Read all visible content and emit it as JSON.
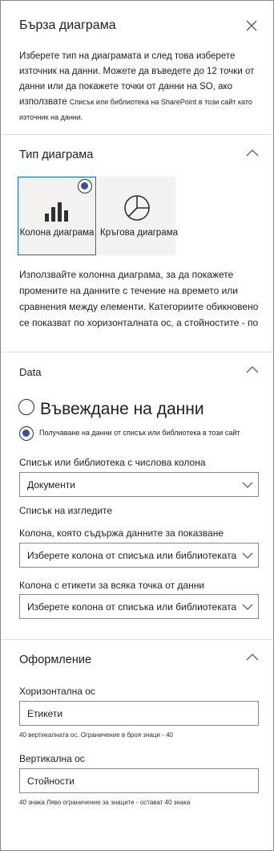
{
  "panel": {
    "title": "Бърза диаграма",
    "intro_main": "Изберете тип на диаграмата и след това изберете източник на данни. Можете да въведете до 12 точки от данни или да покажете точки от данни на SO, ако използвате ",
    "intro_small": "Списък или библиотека на SharePoint в този сайт като източник на данни."
  },
  "chart_type": {
    "section_title": "Тип диаграма",
    "options": [
      {
        "label": "Колона диаграма",
        "icon": "bar-chart-icon",
        "selected": true
      },
      {
        "label": "Кръгова диаграма",
        "icon": "pie-chart-icon",
        "selected": false
      }
    ],
    "description": "Използвайте колонна диаграма, за да покажете промените на данните с течение на времето или сравнения между елементи. Категориите обикновено се показват по хоризонталната ос, а стойностите - по"
  },
  "data": {
    "section_title": "Data",
    "radio_enter": "Въвеждане на данни",
    "radio_list": "Получаване на данни от списък или библиотека в този сайт",
    "list_label": "Списък или библиотека с числова колона",
    "list_value": "Документи",
    "views_label": "Списък на изгледите",
    "column_label": "Колона, която съдържа данните за показване",
    "column_value": "Изберете колона от списъка или библиотеката",
    "labels_column_label": "Колона с етикети за всяка точка от данни",
    "labels_column_value": "Изберете колона от списъка или библиотеката"
  },
  "format": {
    "section_title": "Оформление",
    "h_axis_label": "Хоризонтална ос",
    "h_axis_value": "Етикети",
    "h_axis_hint": "40 вертикалната ос. Ограничение в броя знаци - 40",
    "v_axis_label": "Вертикална ос",
    "v_axis_value": "Стойности",
    "v_axis_hint": "40 знака Ляво ограничение за знаците - остават 40 знака"
  },
  "colors": {
    "accent": "#3a4fa0",
    "border": "#8a8886",
    "divider": "#e1dfdd",
    "card_bg": "#f3f2f1"
  }
}
